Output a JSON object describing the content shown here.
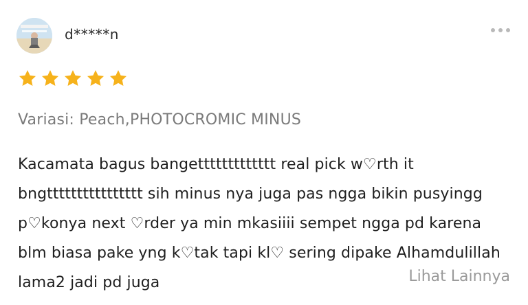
{
  "review": {
    "username": "d*****n",
    "rating": 5,
    "max_rating": 5,
    "variation": "Variasi: Peach,PHOTOCROMIC MINUS",
    "text_lines": [
      "Kacamata bagus bangettttttttttttt real pick w♡rth it",
      "bngtttttttttttttttt sih minus nya juga pas ngga bikin pusyingg",
      "p♡konya next ♡rder ya min mkasiiii sempet ngga pd karena",
      "blm biasa pake yng k♡tak tapi kl♡ sering dipake Alhamdulillah",
      "lama2 jadi pd juga"
    ],
    "see_more_label": "Lihat Lainnya"
  },
  "icons": {
    "more": "more-dots-icon",
    "star": "star-icon",
    "avatar": "avatar-image"
  },
  "colors": {
    "star": "#F6B21B",
    "muted_text": "#7a7a7a",
    "see_more": "#9a9a9a",
    "more_dots": "#b9b9b9"
  }
}
